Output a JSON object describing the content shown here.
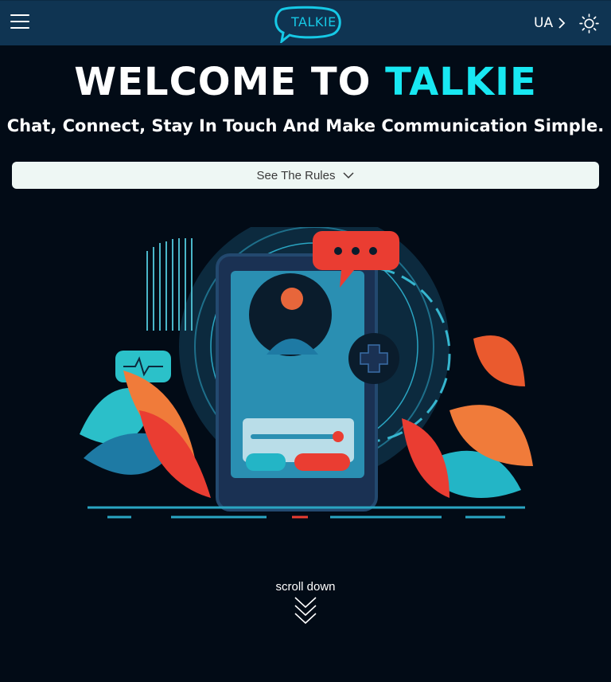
{
  "header": {
    "logo_text": "TALKIE",
    "language": "UA"
  },
  "hero": {
    "title_prefix": "WELCOME TO",
    "title_brand": "TALKIE",
    "subtitle": "Chat, Connect, Stay In Touch And Make Communication Simple."
  },
  "rules_button": {
    "label": "See The Rules"
  },
  "scroll": {
    "label": "scroll down"
  },
  "colors": {
    "background": "#020b16",
    "header": "#0f3452",
    "accent": "#18e8f2",
    "rules_button_bg": "#eef7f4"
  }
}
